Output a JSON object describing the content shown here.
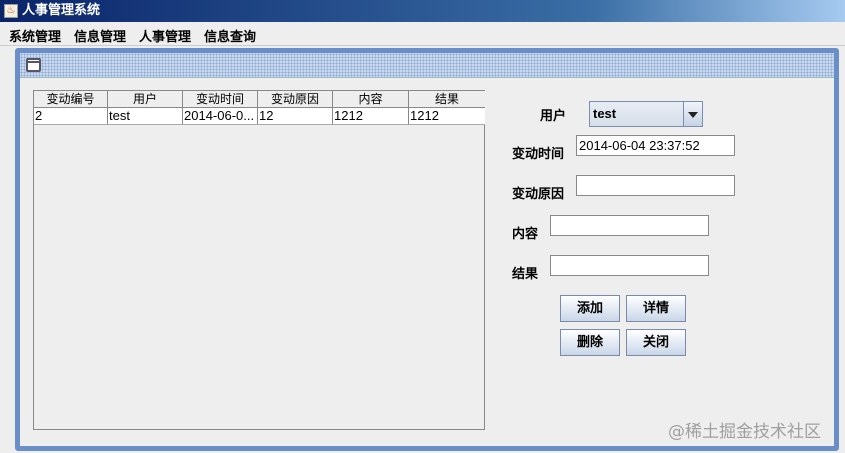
{
  "window": {
    "title": "人事管理系统",
    "icon": "java-icon"
  },
  "menu": [
    "系统管理",
    "信息管理",
    "人事管理",
    "信息查询"
  ],
  "table": {
    "columns": [
      "变动编号",
      "用户",
      "变动时间",
      "变动原因",
      "内容",
      "结果"
    ],
    "rows": [
      [
        "2",
        "test",
        "2014-06-0...",
        "12",
        "1212",
        "1212"
      ]
    ]
  },
  "form": {
    "user_label": "用户",
    "user_value": "test",
    "time_label": "变动时间",
    "time_value": "2014-06-04 23:37:52",
    "reason_label": "变动原因",
    "reason_value": "",
    "content_label": "内容",
    "content_value": "",
    "result_label": "结果",
    "result_value": ""
  },
  "buttons": {
    "add": "添加",
    "detail": "详情",
    "delete": "删除",
    "close": "关闭"
  },
  "watermark": "@稀土掘金技术社区"
}
